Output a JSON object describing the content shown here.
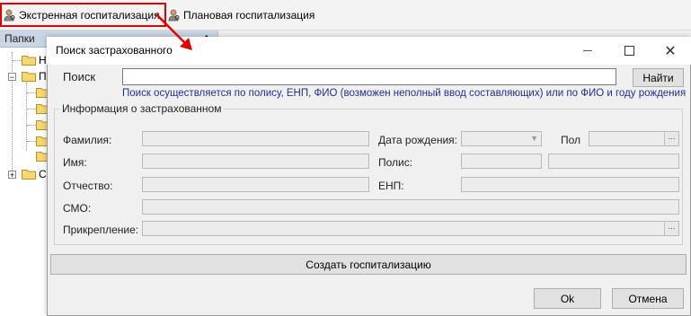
{
  "toolbar": {
    "emergency_label": "Экстренная госпитализация",
    "planned_label": "Плановая госпитализация"
  },
  "folders_panel": {
    "header": "Папки",
    "items": [
      "Н",
      "П",
      "С"
    ]
  },
  "dialog": {
    "title": "Поиск застрахованного",
    "search_label": "Поиск",
    "search_value": "",
    "find_button": "Найти",
    "hint": "Поиск осуществляется по полису, ЕНП, ФИО (возможен неполный ввод составляющих) или по ФИО и году рождения",
    "group_title": "Информация о застрахованном",
    "labels": {
      "surname": "Фамилия:",
      "name": "Имя:",
      "patronymic": "Отчество:",
      "smo": "СМО:",
      "attachment": "Прикрепление:",
      "birth_date": "Дата рождения:",
      "gender": "Пол",
      "policy": "Полис:",
      "enp": "ЕНП:"
    },
    "create_button": "Создать госпитализацию",
    "ok_button": "Ok",
    "cancel_button": "Отмена"
  },
  "colors": {
    "annotation_red": "#e00000",
    "hint_blue": "#1f2f9a"
  }
}
